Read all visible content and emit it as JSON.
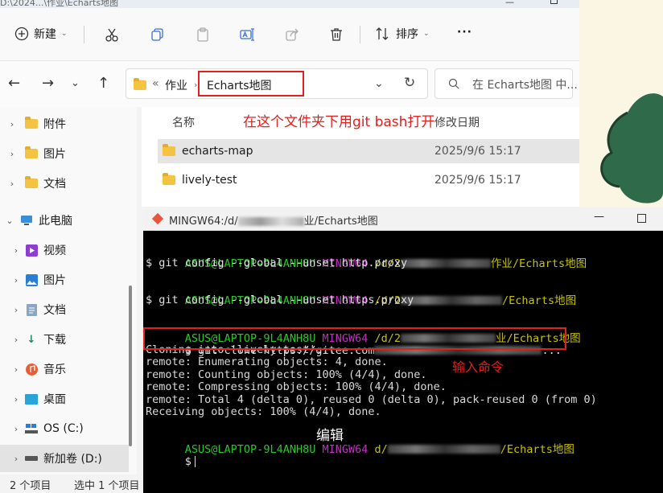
{
  "explorer": {
    "window_title": "D:\\2024...\\作业\\Echarts地图",
    "toolbar": {
      "new_label": "新建",
      "sort_label": "排序",
      "more_label": "···"
    },
    "address": {
      "overflow": "«",
      "crumb_parent": "作业",
      "crumb_current": "Echarts地图",
      "search_placeholder": "在 Echarts地图 中..."
    },
    "sidebar": {
      "items": [
        {
          "label": "附件",
          "icon": "folder-icon"
        },
        {
          "label": "图片",
          "icon": "folder-icon"
        },
        {
          "label": "文档",
          "icon": "folder-icon"
        },
        {
          "label": "此电脑",
          "icon": "computer-icon"
        },
        {
          "label": "视频",
          "icon": "video-icon"
        },
        {
          "label": "图片",
          "icon": "pictures-icon"
        },
        {
          "label": "文档",
          "icon": "documents-icon"
        },
        {
          "label": "下载",
          "icon": "download-icon"
        },
        {
          "label": "音乐",
          "icon": "music-icon"
        },
        {
          "label": "桌面",
          "icon": "desktop-icon"
        },
        {
          "label": "OS (C:)",
          "icon": "drive-icon"
        },
        {
          "label": "新加卷 (D:)",
          "icon": "drive-icon"
        }
      ]
    },
    "columns": {
      "name": "名称",
      "modified": "修改日期"
    },
    "files": [
      {
        "name": "echarts-map",
        "date": "2025/9/6 15:17"
      },
      {
        "name": "lively-test",
        "date": "2025/9/6 15:17"
      }
    ],
    "status": {
      "count": "2 个项目",
      "selected": "选中 1 个项目"
    }
  },
  "annotations": {
    "folder_hint": "在这个文件夹下用git bash打开",
    "command_hint": "输入命令",
    "edit_label": "编辑"
  },
  "bash": {
    "window_title_prefix": "MINGW64:/d/",
    "window_title_suffix": "业/Echarts地图",
    "user_host": "ASUS@LAPTOP-9L4ANH8U",
    "env": "MINGW64",
    "path_prefix_1": "/d/2",
    "path_suffix_1": "作业/Echarts地图",
    "path_prefix_2": "/d/2",
    "path_suffix_2": "/Echarts地图",
    "path_prefix_3": "/d/2",
    "path_suffix_3": "业/Echarts地图",
    "path_prefix_4": "d/",
    "path_suffix_4": "/Echarts地图",
    "commands": {
      "c1": "$ git config --global --unset http.proxy",
      "c2": "$ git config --global --unset https.proxy",
      "c3_prefix": "$ git clone https://gitee.com",
      "c3_suffix": "..."
    },
    "output": [
      "Cloning into 'lively-test'...",
      "remote: Enumerating objects: 4, done.",
      "remote: Counting objects: 100% (4/4), done.",
      "remote: Compressing objects: 100% (4/4), done.",
      "remote: Total 4 (delta 0), reused 0 (delta 0), pack-reused 0 (from 0)",
      "Receiving objects: 100% (4/4), done."
    ],
    "prompt": "$"
  },
  "colors": {
    "annotation_red": "#e0201e",
    "bash_user": "#28c828",
    "bash_env": "#c030c0",
    "bash_path": "#c7c300"
  }
}
